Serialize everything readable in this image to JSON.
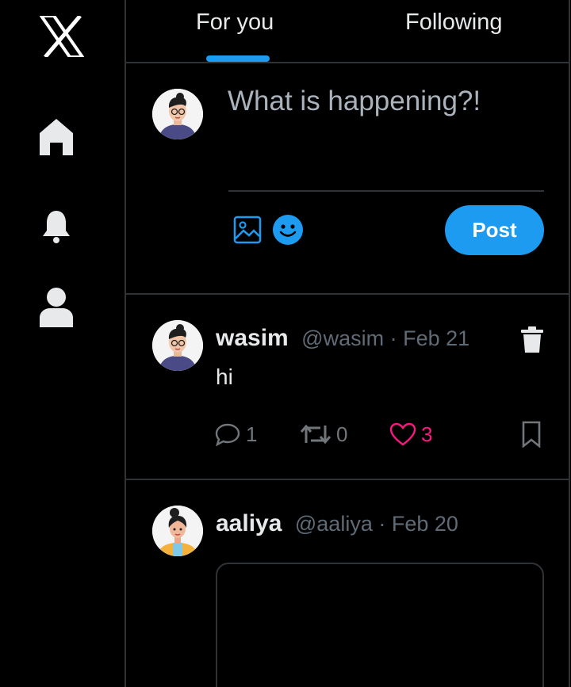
{
  "sidebar": {
    "icons": [
      "x-logo-icon",
      "home-icon",
      "bell-icon",
      "profile-icon"
    ]
  },
  "tabs": [
    {
      "label": "For you",
      "active": true
    },
    {
      "label": "Following",
      "active": false
    }
  ],
  "composer": {
    "placeholder": "What is happening?!",
    "value": "",
    "post_label": "Post",
    "tools": [
      "image-icon",
      "emoji-icon"
    ]
  },
  "posts": [
    {
      "name": "wasim",
      "handle": "@wasim",
      "date": "Feb 21",
      "meta": "@wasim · Feb 21",
      "text": "hi",
      "replies": "1",
      "reposts": "0",
      "likes": "3",
      "liked": true
    },
    {
      "name": "aaliya",
      "handle": "@aaliya",
      "date": "Feb 20",
      "meta": "@aaliya · Feb 20"
    }
  ],
  "colors": {
    "accent": "#1d9bf0",
    "like": "#f91880",
    "border": "#2f3336",
    "muted": "#71767b",
    "background": "#000000"
  }
}
